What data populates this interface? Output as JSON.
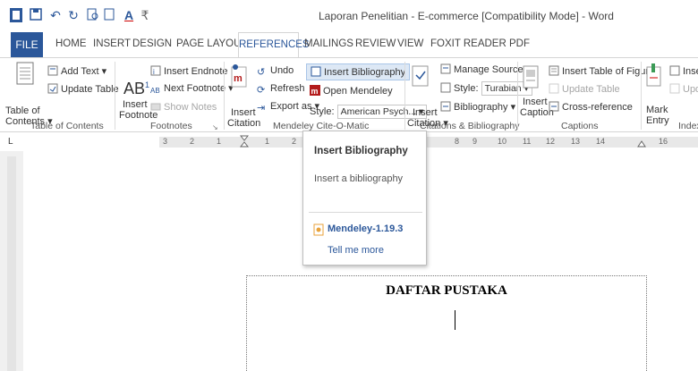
{
  "window": {
    "title": "Laporan Penelitian - E-commerce [Compatibility Mode] - Word"
  },
  "tabs": [
    "FILE",
    "HOME",
    "INSERT",
    "DESIGN",
    "PAGE LAYOUT",
    "REFERENCES",
    "MAILINGS",
    "REVIEW",
    "VIEW",
    "FOXIT READER PDF"
  ],
  "active_tab": "REFERENCES",
  "colors": {
    "accent": "#2b579a",
    "mendeley_red": "#b31b1b",
    "addin_orange": "#e8a23a"
  },
  "ribbon": {
    "toc": {
      "table_of_contents": [
        "Table of",
        "Contents"
      ],
      "add_text": "Add Text",
      "update_table": "Update Table",
      "group_label": "Table of Contents"
    },
    "footnotes": {
      "insert_footnote": [
        "Insert",
        "Footnote"
      ],
      "ab_glyph": "AB",
      "superscript": "1",
      "insert_endnote": "Insert Endnote",
      "next_footnote": "Next Footnote",
      "show_notes": "Show Notes",
      "group_label": "Footnotes"
    },
    "mendeley": {
      "insert_citation": [
        "Insert",
        "Citation"
      ],
      "undo": "Undo",
      "refresh": "Refresh",
      "export_as": "Export as",
      "insert_bibliography": "Insert Bibliography",
      "open_mendeley": "Open Mendeley",
      "style_label": "Style:",
      "style_value": "American Psych...",
      "group_label": "Mendeley Cite-O-Matic"
    },
    "citations": {
      "insert_citation": [
        "Insert",
        "Citation"
      ],
      "manage_sources": "Manage Sources",
      "style_label": "Style:",
      "style_value": "Turabian",
      "bibliography": "Bibliography",
      "group_label": "Citations & Bibliography"
    },
    "captions": {
      "insert_caption": [
        "Insert",
        "Caption"
      ],
      "insert_table_of_figures": "Insert Table of Figures",
      "update_table": "Update Table",
      "cross_reference": "Cross-reference",
      "group_label": "Captions"
    },
    "index": {
      "mark_entry": [
        "Mark",
        "Entry"
      ],
      "insert_index": "Inser",
      "update_index": "Upda",
      "group_label": "Index"
    }
  },
  "ruler": {
    "left_marker": "L",
    "numbers": [
      "3",
      "2",
      "1",
      "1",
      "2",
      "8",
      "9",
      "10",
      "11",
      "12",
      "13",
      "14",
      "16"
    ]
  },
  "tooltip": {
    "title": "Insert Bibliography",
    "description": "Insert a bibliography",
    "addin": "Mendeley-1.19.3",
    "tell_me_more": "Tell me more"
  },
  "document": {
    "heading": "DAFTAR PUSTAKA"
  }
}
